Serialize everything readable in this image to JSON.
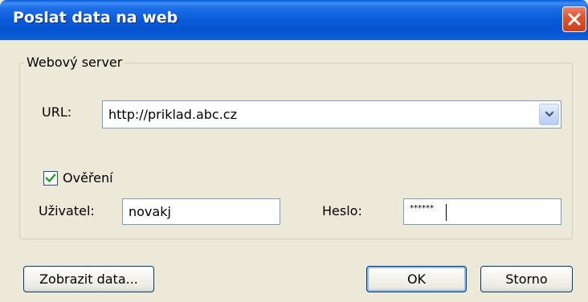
{
  "window": {
    "title": "Poslat data na web"
  },
  "group": {
    "legend": "Webový server"
  },
  "url": {
    "label": "URL:",
    "value": "http://priklad.abc.cz"
  },
  "auth": {
    "label": "Ověření",
    "checked": true
  },
  "user": {
    "label": "Uživatel:",
    "value": "novakj"
  },
  "password": {
    "label": "Heslo:",
    "masked_value": "******"
  },
  "buttons": {
    "show_data": "Zobrazit data...",
    "ok": "OK",
    "cancel": "Storno"
  },
  "colors": {
    "titlebar": "#0a5ad8",
    "dialog_bg": "#ece9d8",
    "close_button": "#e0552f",
    "checkmark": "#21a121"
  }
}
